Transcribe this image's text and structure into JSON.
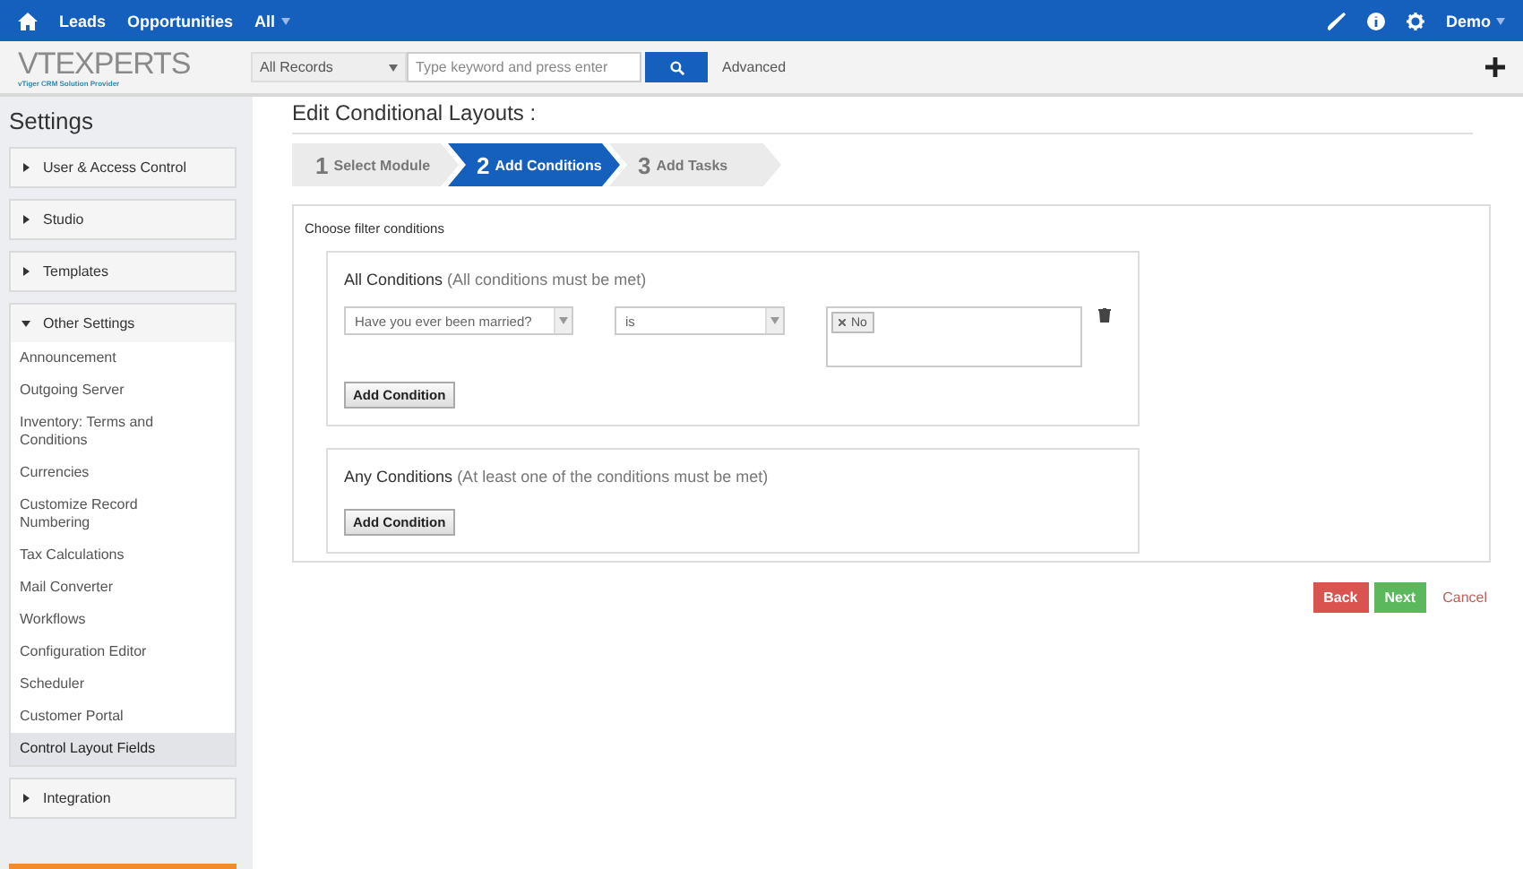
{
  "topbar": {
    "nav": [
      {
        "label": "Leads"
      },
      {
        "label": "Opportunities"
      }
    ],
    "all_menu": "All",
    "user": "Demo"
  },
  "header": {
    "logo": {
      "name": "VTEXPERTS",
      "tagline": "vTiger CRM Solution Provider"
    },
    "search": {
      "scope": "All Records",
      "placeholder": "Type keyword and press enter"
    },
    "advanced": "Advanced"
  },
  "sidebar": {
    "title": "Settings",
    "groups": [
      {
        "label": "User & Access Control",
        "expanded": false
      },
      {
        "label": "Studio",
        "expanded": false
      },
      {
        "label": "Templates",
        "expanded": false
      },
      {
        "label": "Other Settings",
        "expanded": true,
        "items": [
          {
            "label": "Announcement",
            "selected": false
          },
          {
            "label": "Outgoing Server",
            "selected": false
          },
          {
            "label": "Inventory: Terms and Conditions",
            "selected": false
          },
          {
            "label": "Currencies",
            "selected": false
          },
          {
            "label": "Customize Record Numbering",
            "selected": false
          },
          {
            "label": "Tax Calculations",
            "selected": false
          },
          {
            "label": "Mail Converter",
            "selected": false
          },
          {
            "label": "Workflows",
            "selected": false
          },
          {
            "label": "Configuration Editor",
            "selected": false
          },
          {
            "label": "Scheduler",
            "selected": false
          },
          {
            "label": "Customer Portal",
            "selected": false
          },
          {
            "label": "Control Layout Fields",
            "selected": true
          }
        ]
      },
      {
        "label": "Integration",
        "expanded": false
      }
    ]
  },
  "page_title": "Edit Conditional Layouts :",
  "steps": [
    {
      "number": "1",
      "label": "Select Module",
      "selected": false
    },
    {
      "number": "2",
      "label": "Add Conditions",
      "selected": true
    },
    {
      "number": "3",
      "label": "Add Tasks",
      "selected": false
    }
  ],
  "filter": {
    "title": "Choose filter conditions",
    "groups": [
      {
        "title": "All Conditions",
        "hint": "(All conditions must be met)",
        "rows": [
          {
            "field": "Have you ever been married?",
            "operator": "is",
            "values": [
              "No"
            ]
          }
        ],
        "button": "Add Condition"
      },
      {
        "title": "Any Conditions",
        "hint": "(At least one of the conditions must be met)",
        "button": "Add Condition"
      }
    ]
  },
  "actions": {
    "back": "Back",
    "next": "Next",
    "cancel": "Cancel"
  }
}
